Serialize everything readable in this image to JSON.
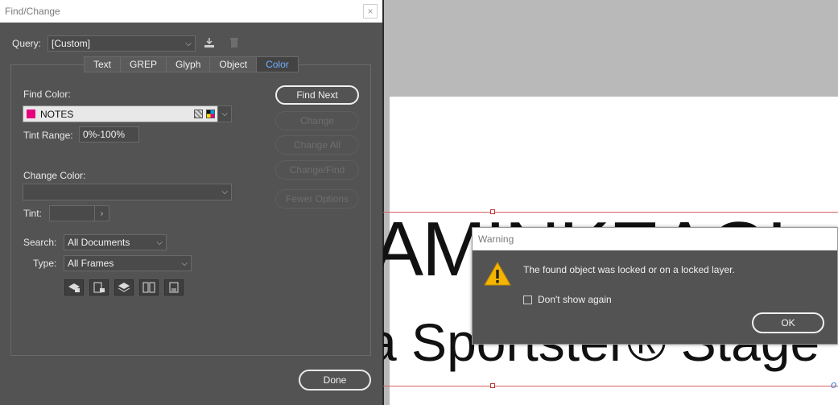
{
  "findchange": {
    "title": "Find/Change",
    "close_glyph": "×",
    "query_label": "Query:",
    "query_value": "[Custom]",
    "tabs": [
      {
        "label": "Text"
      },
      {
        "label": "GREP"
      },
      {
        "label": "Glyph"
      },
      {
        "label": "Object"
      },
      {
        "label": "Color",
        "active": true
      }
    ],
    "find_color_label": "Find Color:",
    "find_color_value": "NOTES",
    "find_color_swatch": "#e6007e",
    "tint_range_label": "Tint Range:",
    "tint_range_value": "0%-100%",
    "change_color_label": "Change Color:",
    "change_color_value": "",
    "tint_label": "Tint:",
    "tint_value": "",
    "search_label": "Search:",
    "search_value": "All Documents",
    "type_label": "Type:",
    "type_value": "All Frames",
    "buttons": {
      "find_next": "Find Next",
      "change": "Change",
      "change_all": "Change All",
      "change_find": "Change/Find",
      "fewer_options": "Fewer Options",
      "done": "Done"
    },
    "option_icons": [
      "include-locked-layers-icon",
      "include-locked-stories-icon",
      "include-hidden-layers-icon",
      "include-master-pages-icon",
      "include-footnotes-icon"
    ]
  },
  "warning": {
    "title": "Warning",
    "message": "The found object was locked or on a locked layer.",
    "checkbox_label": "Don't show again",
    "checkbox_checked": false,
    "ok_label": "OK"
  },
  "canvas": {
    "big_text": "AMINKEAGL",
    "sub_text": "a Sportster® Stage",
    "overflow_glyph": "o"
  }
}
